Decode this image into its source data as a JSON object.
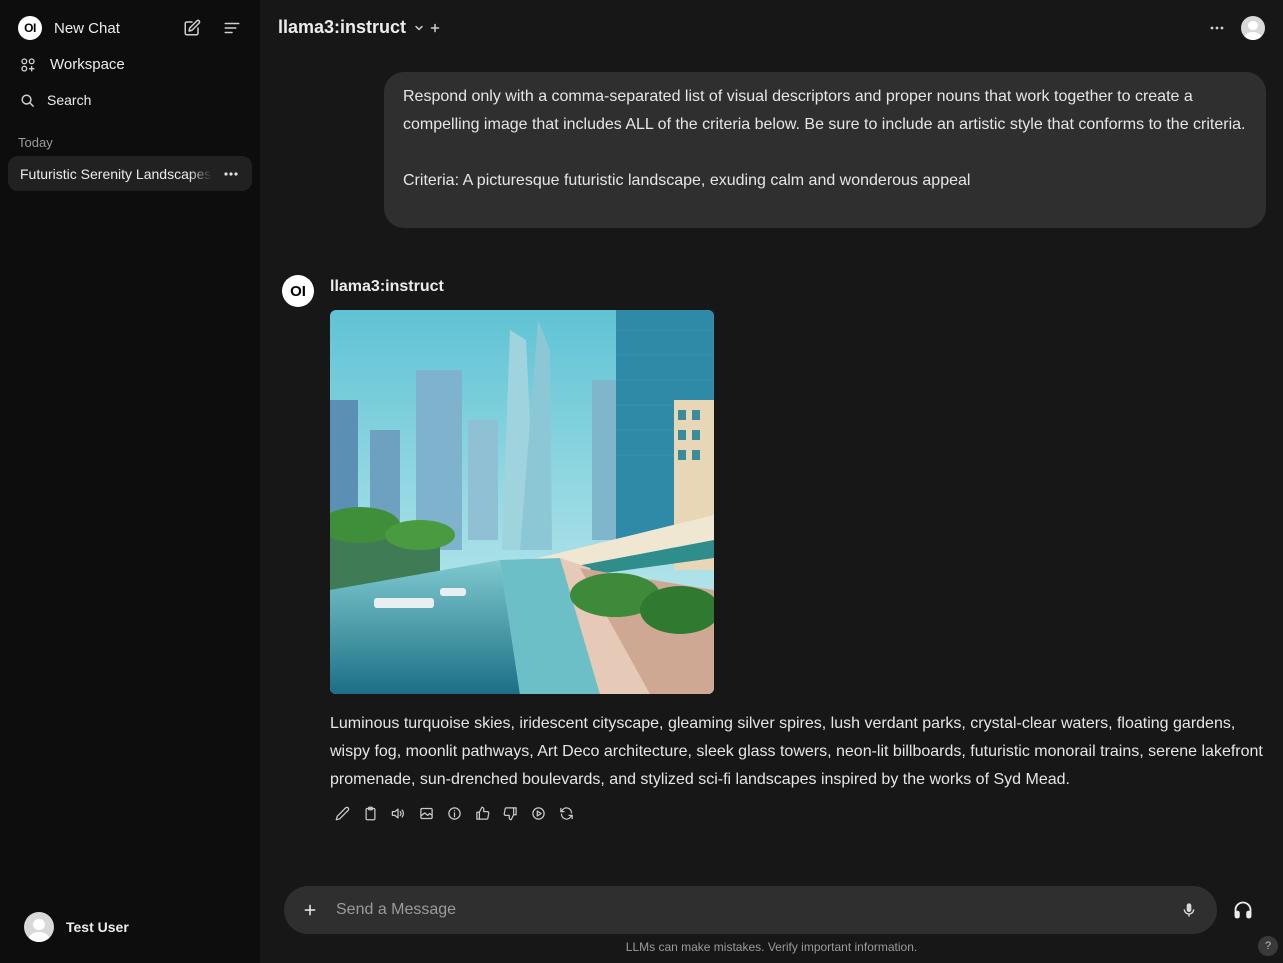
{
  "sidebar": {
    "logo_text": "OI",
    "new_chat_label": "New Chat",
    "workspace_label": "Workspace",
    "search_label": "Search",
    "section_today": "Today",
    "chats": [
      {
        "label": "Futuristic Serenity Landscapes"
      }
    ],
    "user_name": "Test User"
  },
  "header": {
    "model_name": "llama3:instruct"
  },
  "conversation": {
    "user_message_p1": "Respond only with a comma-separated list of visual descriptors and proper nouns that work together to create a compelling image that includes ALL of the criteria below. Be sure to include an artistic style that conforms to the criteria.",
    "user_message_p2": "Criteria: A picturesque futuristic landscape, exuding calm and wonderous appeal",
    "assistant_logo": "OI",
    "assistant_name": "llama3:instruct",
    "assistant_response": "Luminous turquoise skies, iridescent cityscape, gleaming silver spires, lush verdant parks, crystal-clear waters, floating gardens, wispy fog, moonlit pathways, Art Deco architecture, sleek glass towers, neon-lit billboards, futuristic monorail trains, serene lakefront promenade, sun-drenched boulevards, and stylized sci-fi landscapes inspired by the works of Syd Mead.",
    "action_icons": [
      "edit-icon",
      "copy-icon",
      "read-aloud-icon",
      "generate-image-icon",
      "info-icon",
      "thumbs-up-icon",
      "thumbs-down-icon",
      "continue-icon",
      "regenerate-icon"
    ]
  },
  "composer": {
    "placeholder": "Send a Message"
  },
  "footer": {
    "disclaimer": "LLMs can make mistakes. Verify important information.",
    "help_label": "?"
  },
  "colors": {
    "sidebar_bg": "#0d0d0d",
    "main_bg": "#171717",
    "bubble_bg": "#2f2f2f",
    "text": "#ececec"
  }
}
